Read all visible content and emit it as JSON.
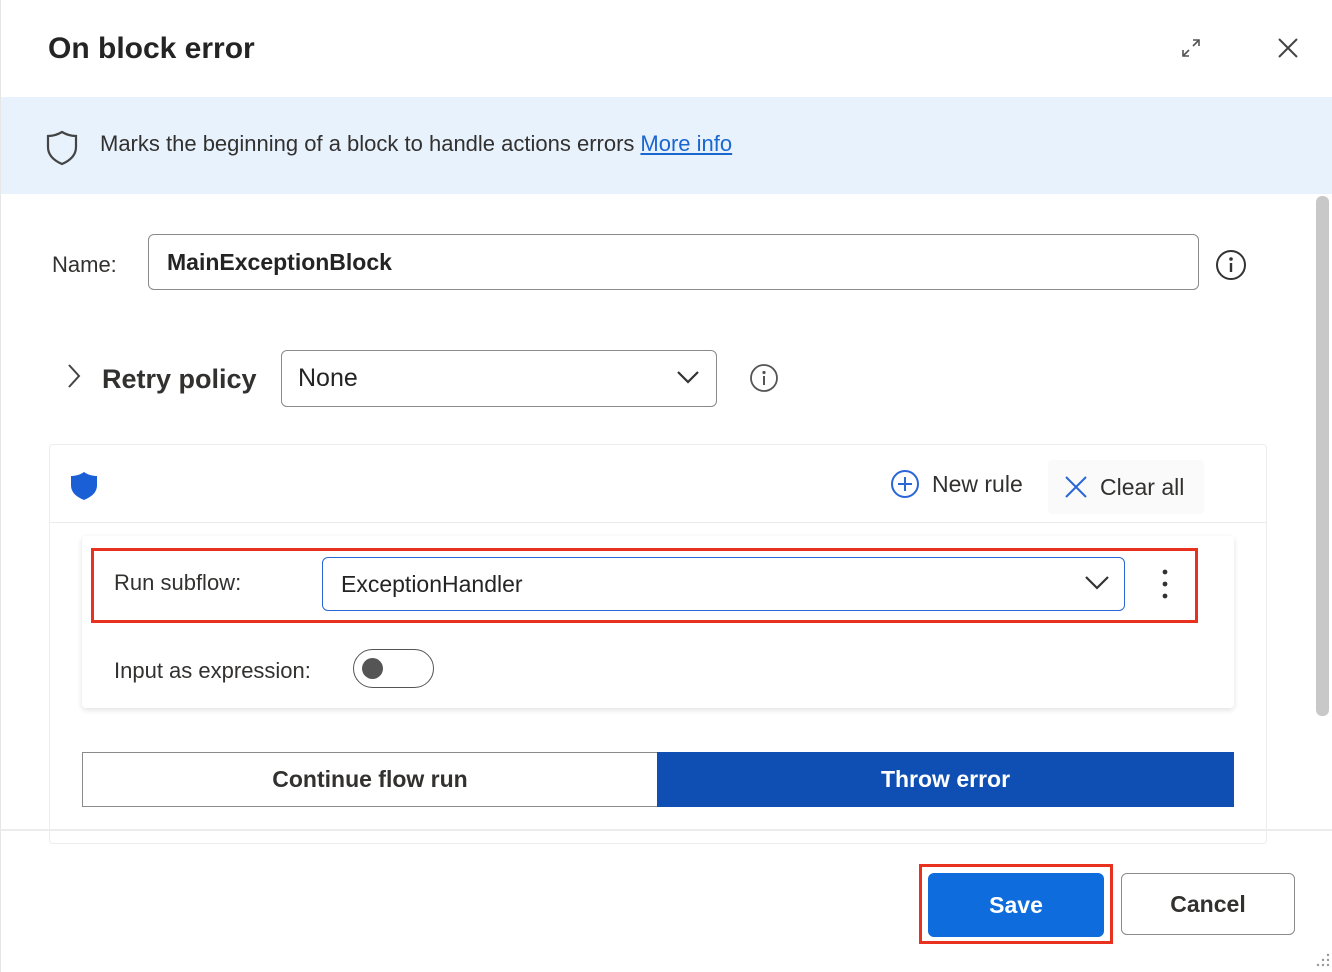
{
  "dialog": {
    "title": "On block error"
  },
  "banner": {
    "text": "Marks the beginning of a block to handle actions errors",
    "link": "More info"
  },
  "name": {
    "label": "Name:",
    "value": "MainExceptionBlock"
  },
  "retry_policy": {
    "label": "Retry policy",
    "selected": "None"
  },
  "rules": {
    "new_rule": "New rule",
    "clear_all": "Clear all",
    "run_subflow_label": "Run subflow:",
    "run_subflow_value": "ExceptionHandler",
    "input_expression_label": "Input as expression:",
    "input_expression_on": false
  },
  "mode": {
    "continue": "Continue flow run",
    "throw": "Throw error",
    "selected": "Throw error"
  },
  "footer": {
    "save": "Save",
    "cancel": "Cancel"
  },
  "colors": {
    "accent": "#0f6cdc",
    "selected_segment": "#0f4fb3",
    "highlight": "#e8321f",
    "banner_bg": "#e8f2fc"
  }
}
